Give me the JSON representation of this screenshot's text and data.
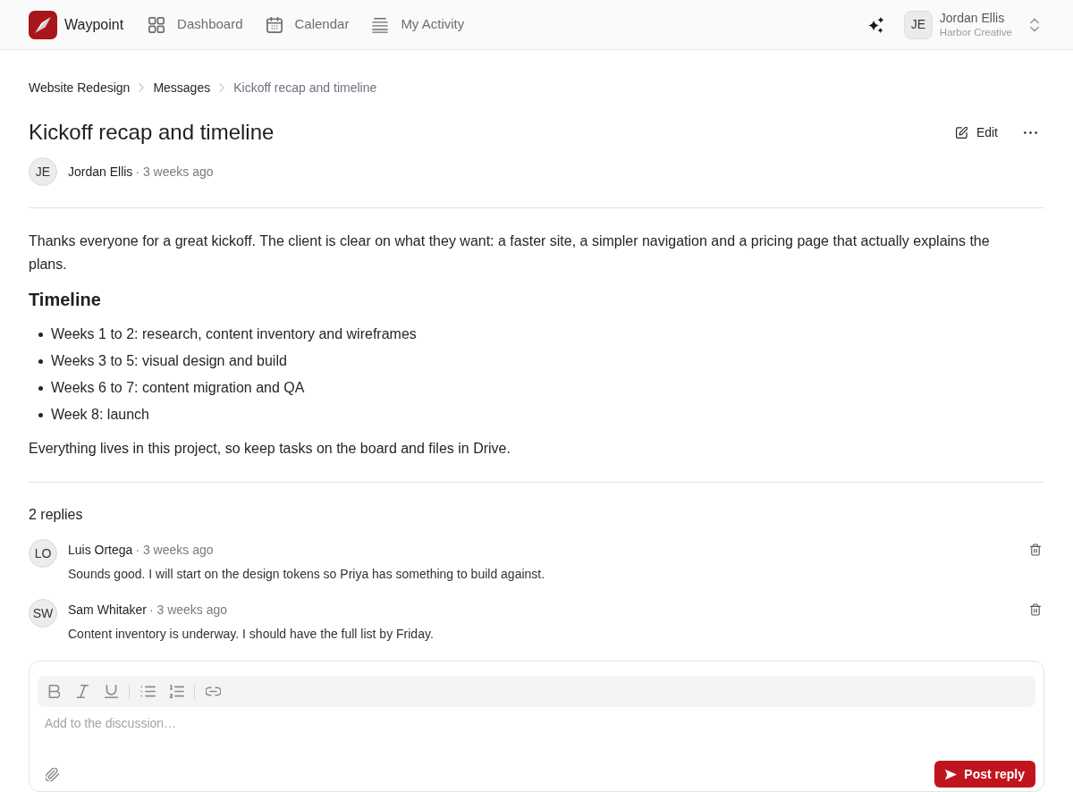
{
  "nav": {
    "brand": "Waypoint",
    "items": [
      {
        "label": "Dashboard"
      },
      {
        "label": "Calendar"
      },
      {
        "label": "My Activity"
      }
    ],
    "user": {
      "initials": "JE",
      "name": "Jordan Ellis",
      "org": "Harbor Creative"
    }
  },
  "breadcrumb": [
    {
      "label": "Website Redesign"
    },
    {
      "label": "Messages"
    },
    {
      "label": "Kickoff recap and timeline"
    }
  ],
  "message": {
    "title": "Kickoff recap and timeline",
    "edit_label": "Edit",
    "author": {
      "initials": "JE",
      "name": "Jordan Ellis",
      "time": "· 3 weeks ago"
    },
    "body": [
      {
        "kind": "paragraph",
        "text": "Thanks everyone for a great kickoff. The client is clear on what they want: a faster site, a simpler navigation and a pricing page that actually explains the plans."
      },
      {
        "kind": "heading",
        "text": "Timeline"
      },
      {
        "kind": "list",
        "items": [
          "Weeks 1 to 2: research, content inventory and wireframes",
          "Weeks 3 to 5: visual design and build",
          "Weeks 6 to 7: content migration and QA",
          "Week 8: launch"
        ]
      },
      {
        "kind": "paragraph",
        "text": "Everything lives in this project, so keep tasks on the board and files in Drive."
      }
    ]
  },
  "replies": {
    "count": "2 replies",
    "items": [
      {
        "initials": "LO",
        "name": "Luis Ortega",
        "time": "· 3 weeks ago",
        "text": "Sounds good. I will start on the design tokens so Priya has something to build against."
      },
      {
        "initials": "SW",
        "name": "Sam Whitaker",
        "time": "· 3 weeks ago",
        "text": "Content inventory is underway. I should have the full list by Friday."
      }
    ]
  },
  "composer": {
    "placeholder": "Add to the discussion…",
    "submit_label": "Post reply"
  }
}
